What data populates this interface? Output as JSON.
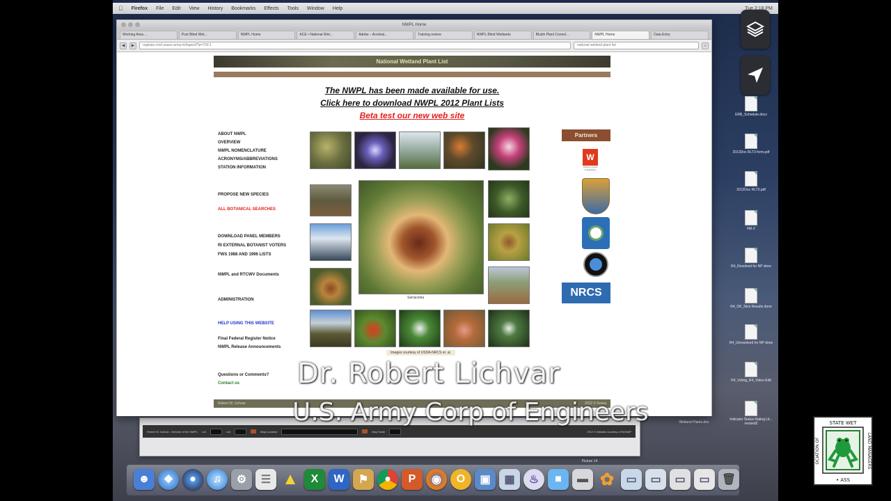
{
  "menubar": {
    "apple": "",
    "items": [
      "Firefox",
      "File",
      "Edit",
      "View",
      "History",
      "Bookmarks",
      "Effects",
      "Tools",
      "Window",
      "Help"
    ],
    "clock": "Tue 2:18 PM"
  },
  "browser": {
    "window_title": "NWPL Home",
    "tabs": [
      "Working Area ...",
      "Post Blind Wet...",
      "NWPL Home",
      "ACE • National Wet...",
      "Adobe – Acrobat...",
      "Training review",
      "NWPL Blind Wetlands",
      "Bluish Plant Consol...",
      "NWPL Home",
      "Data Entry"
    ],
    "active_tab_index": 8,
    "url": "rsgisias.crrel.usace.army.mil/apex/f?p=703:1",
    "search_placeholder": "national wetland plant list"
  },
  "nwpl": {
    "banner": "National Wetland Plant List",
    "notice1": "The NWPL has been made available for use.",
    "notice2": "Click here to download NWPL 2012 Plant Lists",
    "notice3": "Beta test our new web site",
    "nav": [
      {
        "label": "ABOUT NWPL",
        "style": "normal"
      },
      {
        "label": "OVERVIEW",
        "style": "normal"
      },
      {
        "label": "NWPL NOMENCLATURE",
        "style": "normal"
      },
      {
        "label": "ACRONYMS/ABBREVIATIONS",
        "style": "normal"
      },
      {
        "label": "STATION INFORMATION",
        "style": "normal"
      },
      {
        "label": "PROPOSE NEW SPECIES",
        "style": "normal"
      },
      {
        "label": "ALL BOTANICAL SEARCHES",
        "style": "red"
      },
      {
        "label": "DOWNLOAD PANEL MEMBERS",
        "style": "normal"
      },
      {
        "label": "RI EXTERNAL BOTANIST VOTERS",
        "style": "normal"
      },
      {
        "label": "FWS 1988 AND 1996 LISTS",
        "style": "normal"
      },
      {
        "label": "NWPL and RTCWV Documents",
        "style": "normal"
      },
      {
        "label": "ADMINISTRATION",
        "style": "normal"
      },
      {
        "label": "HELP USING THIS WEBSITE",
        "style": "blue"
      },
      {
        "label": "Final Federal Register Notice",
        "style": "normal"
      },
      {
        "label": "NWPL Release Announcements",
        "style": "normal"
      },
      {
        "label": "Questions or Comments?",
        "style": "normal"
      },
      {
        "label": "Contact us",
        "style": "green"
      }
    ],
    "center_caption": "Sarracenia",
    "images_credit": "Images courtesy of USDA-NRCS et. al.",
    "partners_header": "Partners",
    "partners": [
      {
        "name": "US Army Corps of Engineers",
        "color": "#e03a1e"
      },
      {
        "name": "US Fish & Wildlife Service",
        "color": "#c79a2d"
      },
      {
        "name": "EPA",
        "color": "#2c6fb7"
      },
      {
        "name": "BONAP",
        "color": "#1b3e8b"
      },
      {
        "name": "NRCS",
        "color": "#2f6bb1"
      }
    ],
    "footer_left": "Robert W. Lichvar",
    "footer_right": "2012 © Korea"
  },
  "second_window": {
    "title": "Robert W. Lichvar - Director of the NWPL",
    "fields": [
      "Lat",
      "Lon",
      "Map Location",
      "Map Scale"
    ],
    "footer_note": "2012 © Ablastic courtesy of BONAP"
  },
  "desktop_icons": [
    "ERB_Schedule.docx",
    "2013Doc RLT3 form.pdf",
    "2012Doc RLT3.pdf",
    "NR-2",
    "R4_Resolved for NP done",
    "R4_OK_Nick Results done",
    "R4_Unresolved for NP done",
    "R4_Voting_R4_Video Edit",
    "Indicator Status Rating Lit... revised2"
  ],
  "desktop_bottom_labels": [
    "Wetland Plants.doc",
    "Picture 14"
  ],
  "captions": {
    "name": "Dr. Robert Lichvar",
    "organization": "U.S. Army Corp of Engineers"
  },
  "association_logo": {
    "text": "ASSOCIATION OF STATE WETLAND MANAGERS"
  }
}
